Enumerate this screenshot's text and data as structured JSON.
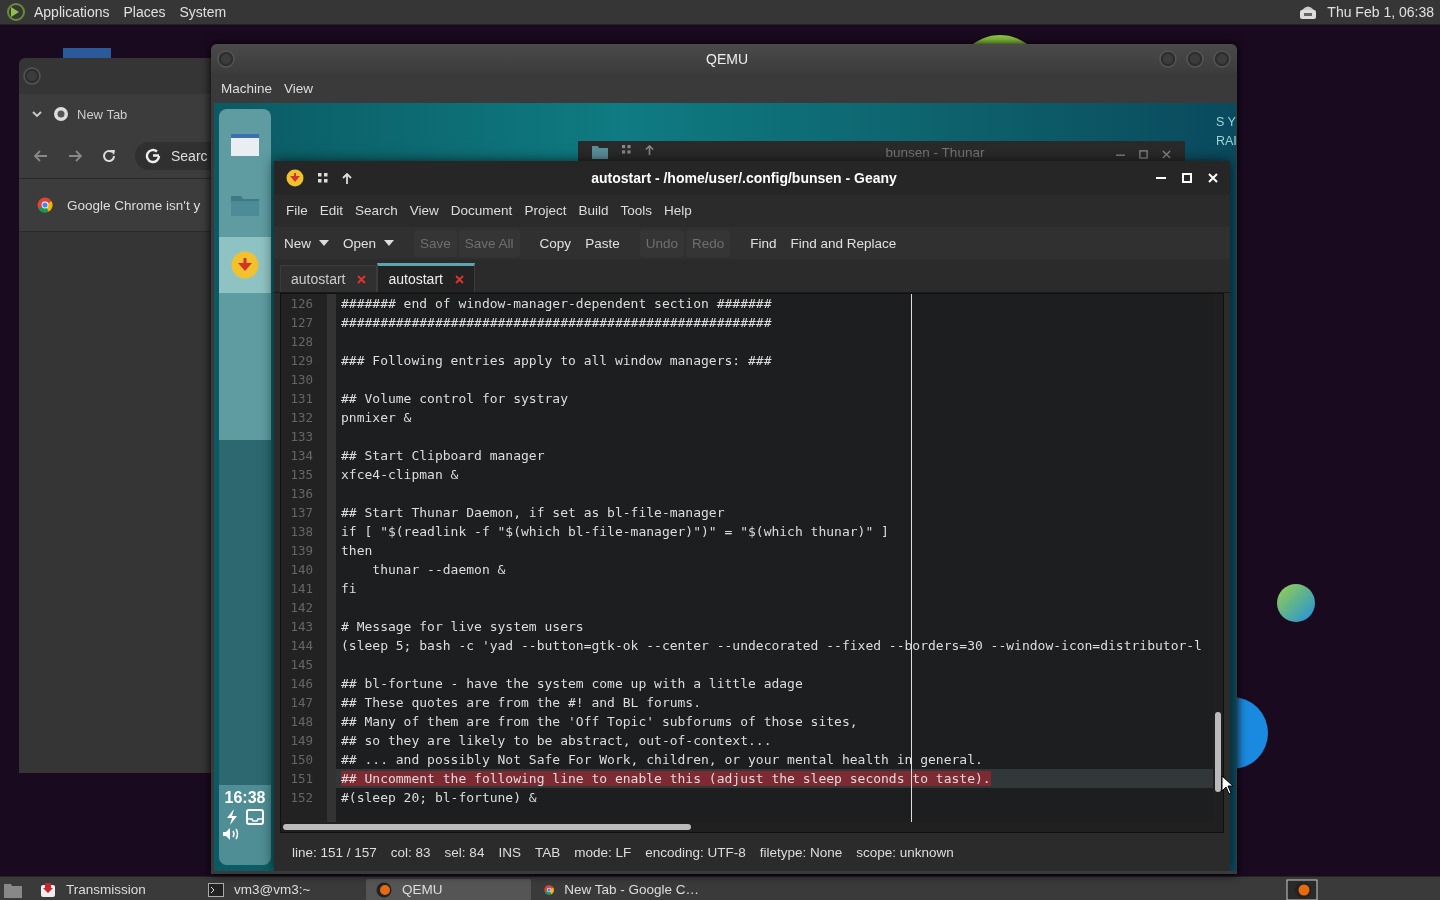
{
  "top_panel": {
    "menus": [
      "Applications",
      "Places",
      "System"
    ],
    "clock": "Thu Feb 1, 06:38"
  },
  "chrome_window": {
    "tab": "New Tab",
    "address": "Searc",
    "infobar": "Google Chrome isn't y"
  },
  "qemu_window": {
    "title": "QEMU",
    "menus": [
      "Machine",
      "View"
    ],
    "guest": {
      "dock_items": [
        {
          "kind": "window",
          "selected": false
        },
        {
          "kind": "folder",
          "selected": false
        },
        {
          "kind": "lamp",
          "selected": true
        }
      ],
      "dock_clock": "16:38",
      "conky": [
        "S Y",
        "RAI"
      ],
      "thunar": {
        "title": "bunsen - Thunar"
      },
      "geany": {
        "title": "autostart - /home/user/.config/bunsen - Geany",
        "menus": [
          "File",
          "Edit",
          "Search",
          "View",
          "Document",
          "Project",
          "Build",
          "Tools",
          "Help"
        ],
        "toolbar": [
          [
            {
              "label": "New",
              "kind": "dropdown",
              "disabled": false
            },
            {
              "label": "Open",
              "kind": "dropdown",
              "disabled": false
            }
          ],
          [
            {
              "label": "Save",
              "kind": "button",
              "disabled": true
            },
            {
              "label": "Save All",
              "kind": "button",
              "disabled": true
            }
          ],
          [
            {
              "label": "Copy",
              "kind": "button",
              "disabled": false
            },
            {
              "label": "Paste",
              "kind": "button",
              "disabled": false
            }
          ],
          [
            {
              "label": "Undo",
              "kind": "button",
              "disabled": true
            },
            {
              "label": "Redo",
              "kind": "button",
              "disabled": true
            }
          ],
          [
            {
              "label": "Find",
              "kind": "button",
              "disabled": false
            },
            {
              "label": "Find and Replace",
              "kind": "button",
              "disabled": false
            }
          ]
        ],
        "tabs": [
          {
            "label": "autostart",
            "selected": false
          },
          {
            "label": "autostart",
            "selected": true
          }
        ],
        "lines": [
          {
            "number": "126",
            "text": "####### end of window-manager-dependent section #######",
            "selected": false,
            "current": false
          },
          {
            "number": "127",
            "text": "#######################################################",
            "selected": false,
            "current": false
          },
          {
            "number": "128",
            "selected": false,
            "current": false
          },
          {
            "number": "129",
            "text": "### Following entries apply to all window managers: ###",
            "selected": false,
            "current": false
          },
          {
            "number": "130",
            "selected": false,
            "current": false
          },
          {
            "number": "131",
            "text": "## Volume control for systray",
            "selected": false,
            "current": false
          },
          {
            "number": "132",
            "text": "pnmixer &",
            "selected": false,
            "current": false
          },
          {
            "number": "133",
            "selected": false,
            "current": false
          },
          {
            "number": "134",
            "text": "## Start Clipboard manager",
            "selected": false,
            "current": false
          },
          {
            "number": "135",
            "text": "xfce4-clipman &",
            "selected": false,
            "current": false
          },
          {
            "number": "136",
            "selected": false,
            "current": false
          },
          {
            "number": "137",
            "text": "## Start Thunar Daemon, if set as bl-file-manager",
            "selected": false,
            "current": false
          },
          {
            "number": "138",
            "text": "if [ \"$(readlink -f \"$(which bl-file-manager)\")\" = \"$(which thunar)\" ]",
            "selected": false,
            "current": false
          },
          {
            "number": "139",
            "text": "then",
            "selected": false,
            "current": false
          },
          {
            "number": "140",
            "text": "    thunar --daemon &",
            "selected": false,
            "current": false
          },
          {
            "number": "141",
            "text": "fi",
            "selected": false,
            "current": false
          },
          {
            "number": "142",
            "selected": false,
            "current": false
          },
          {
            "number": "143",
            "text": "# Message for live system users",
            "selected": false,
            "current": false
          },
          {
            "number": "144",
            "text": "(sleep 5; bash -c 'yad --button=gtk-ok --center --undecorated --fixed --borders=30 --window-icon=distributor-l",
            "selected": false,
            "current": false
          },
          {
            "number": "145",
            "selected": false,
            "current": false
          },
          {
            "number": "146",
            "text": "## bl-fortune - have the system come up with a little adage",
            "selected": false,
            "current": false
          },
          {
            "number": "147",
            "text": "## These quotes are from the #! and BL forums.",
            "selected": false,
            "current": false
          },
          {
            "number": "148",
            "text": "## Many of them are from the 'Off Topic' subforums of those sites,",
            "selected": false,
            "current": false
          },
          {
            "number": "149",
            "text": "## so they are likely to be abstract, out-of-context...",
            "selected": false,
            "current": false
          },
          {
            "number": "150",
            "text": "## ... and possibly Not Safe For Work, children, or your mental health in general.",
            "selected": false,
            "current": false
          },
          {
            "number": "151",
            "text": "## Uncomment the following line to enable this (adjust the sleep seconds to taste).",
            "selected": true,
            "current": true
          },
          {
            "number": "152",
            "text": "#(sleep 20; bl-fortune) &",
            "selected": false,
            "current": false
          }
        ],
        "status": [
          "line: 151 / 157",
          "col: 83",
          "sel: 84",
          "INS",
          "TAB",
          "mode: LF",
          "encoding: UTF-8",
          "filetype: None",
          "scope: unknown"
        ]
      }
    }
  },
  "taskbar": {
    "items": [
      {
        "label": "Transmission",
        "kind": "transmission",
        "selected": false
      },
      {
        "label": "vm3@vm3:~",
        "kind": "terminal",
        "selected": false
      },
      {
        "label": "QEMU",
        "kind": "qemu",
        "selected": true
      },
      {
        "label": "New Tab - Google C…",
        "kind": "browser",
        "selected": false
      }
    ]
  }
}
